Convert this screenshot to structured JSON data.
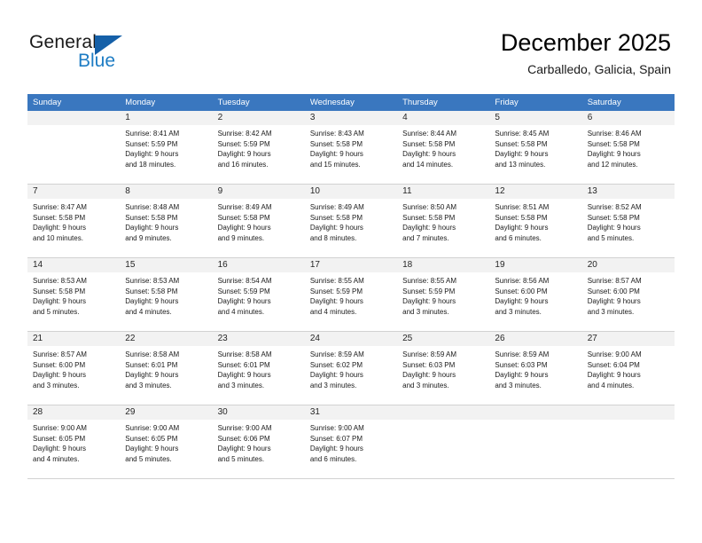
{
  "brand": {
    "name_part1": "General",
    "name_part2": "Blue",
    "triangle_color": "#1560a8",
    "blue_color": "#1d7cc4"
  },
  "header": {
    "title": "December 2025",
    "location": "Carballedo, Galicia, Spain"
  },
  "calendar": {
    "header_bg": "#3a77bf",
    "header_text_color": "#ffffff",
    "weekdays": [
      "Sunday",
      "Monday",
      "Tuesday",
      "Wednesday",
      "Thursday",
      "Friday",
      "Saturday"
    ],
    "weeks": [
      [
        {
          "day": "",
          "sunrise": "",
          "sunset": "",
          "daylight_line1": "",
          "daylight_line2": ""
        },
        {
          "day": "1",
          "sunrise": "Sunrise: 8:41 AM",
          "sunset": "Sunset: 5:59 PM",
          "daylight_line1": "Daylight: 9 hours",
          "daylight_line2": "and 18 minutes."
        },
        {
          "day": "2",
          "sunrise": "Sunrise: 8:42 AM",
          "sunset": "Sunset: 5:59 PM",
          "daylight_line1": "Daylight: 9 hours",
          "daylight_line2": "and 16 minutes."
        },
        {
          "day": "3",
          "sunrise": "Sunrise: 8:43 AM",
          "sunset": "Sunset: 5:58 PM",
          "daylight_line1": "Daylight: 9 hours",
          "daylight_line2": "and 15 minutes."
        },
        {
          "day": "4",
          "sunrise": "Sunrise: 8:44 AM",
          "sunset": "Sunset: 5:58 PM",
          "daylight_line1": "Daylight: 9 hours",
          "daylight_line2": "and 14 minutes."
        },
        {
          "day": "5",
          "sunrise": "Sunrise: 8:45 AM",
          "sunset": "Sunset: 5:58 PM",
          "daylight_line1": "Daylight: 9 hours",
          "daylight_line2": "and 13 minutes."
        },
        {
          "day": "6",
          "sunrise": "Sunrise: 8:46 AM",
          "sunset": "Sunset: 5:58 PM",
          "daylight_line1": "Daylight: 9 hours",
          "daylight_line2": "and 12 minutes."
        }
      ],
      [
        {
          "day": "7",
          "sunrise": "Sunrise: 8:47 AM",
          "sunset": "Sunset: 5:58 PM",
          "daylight_line1": "Daylight: 9 hours",
          "daylight_line2": "and 10 minutes."
        },
        {
          "day": "8",
          "sunrise": "Sunrise: 8:48 AM",
          "sunset": "Sunset: 5:58 PM",
          "daylight_line1": "Daylight: 9 hours",
          "daylight_line2": "and 9 minutes."
        },
        {
          "day": "9",
          "sunrise": "Sunrise: 8:49 AM",
          "sunset": "Sunset: 5:58 PM",
          "daylight_line1": "Daylight: 9 hours",
          "daylight_line2": "and 9 minutes."
        },
        {
          "day": "10",
          "sunrise": "Sunrise: 8:49 AM",
          "sunset": "Sunset: 5:58 PM",
          "daylight_line1": "Daylight: 9 hours",
          "daylight_line2": "and 8 minutes."
        },
        {
          "day": "11",
          "sunrise": "Sunrise: 8:50 AM",
          "sunset": "Sunset: 5:58 PM",
          "daylight_line1": "Daylight: 9 hours",
          "daylight_line2": "and 7 minutes."
        },
        {
          "day": "12",
          "sunrise": "Sunrise: 8:51 AM",
          "sunset": "Sunset: 5:58 PM",
          "daylight_line1": "Daylight: 9 hours",
          "daylight_line2": "and 6 minutes."
        },
        {
          "day": "13",
          "sunrise": "Sunrise: 8:52 AM",
          "sunset": "Sunset: 5:58 PM",
          "daylight_line1": "Daylight: 9 hours",
          "daylight_line2": "and 5 minutes."
        }
      ],
      [
        {
          "day": "14",
          "sunrise": "Sunrise: 8:53 AM",
          "sunset": "Sunset: 5:58 PM",
          "daylight_line1": "Daylight: 9 hours",
          "daylight_line2": "and 5 minutes."
        },
        {
          "day": "15",
          "sunrise": "Sunrise: 8:53 AM",
          "sunset": "Sunset: 5:58 PM",
          "daylight_line1": "Daylight: 9 hours",
          "daylight_line2": "and 4 minutes."
        },
        {
          "day": "16",
          "sunrise": "Sunrise: 8:54 AM",
          "sunset": "Sunset: 5:59 PM",
          "daylight_line1": "Daylight: 9 hours",
          "daylight_line2": "and 4 minutes."
        },
        {
          "day": "17",
          "sunrise": "Sunrise: 8:55 AM",
          "sunset": "Sunset: 5:59 PM",
          "daylight_line1": "Daylight: 9 hours",
          "daylight_line2": "and 4 minutes."
        },
        {
          "day": "18",
          "sunrise": "Sunrise: 8:55 AM",
          "sunset": "Sunset: 5:59 PM",
          "daylight_line1": "Daylight: 9 hours",
          "daylight_line2": "and 3 minutes."
        },
        {
          "day": "19",
          "sunrise": "Sunrise: 8:56 AM",
          "sunset": "Sunset: 6:00 PM",
          "daylight_line1": "Daylight: 9 hours",
          "daylight_line2": "and 3 minutes."
        },
        {
          "day": "20",
          "sunrise": "Sunrise: 8:57 AM",
          "sunset": "Sunset: 6:00 PM",
          "daylight_line1": "Daylight: 9 hours",
          "daylight_line2": "and 3 minutes."
        }
      ],
      [
        {
          "day": "21",
          "sunrise": "Sunrise: 8:57 AM",
          "sunset": "Sunset: 6:00 PM",
          "daylight_line1": "Daylight: 9 hours",
          "daylight_line2": "and 3 minutes."
        },
        {
          "day": "22",
          "sunrise": "Sunrise: 8:58 AM",
          "sunset": "Sunset: 6:01 PM",
          "daylight_line1": "Daylight: 9 hours",
          "daylight_line2": "and 3 minutes."
        },
        {
          "day": "23",
          "sunrise": "Sunrise: 8:58 AM",
          "sunset": "Sunset: 6:01 PM",
          "daylight_line1": "Daylight: 9 hours",
          "daylight_line2": "and 3 minutes."
        },
        {
          "day": "24",
          "sunrise": "Sunrise: 8:59 AM",
          "sunset": "Sunset: 6:02 PM",
          "daylight_line1": "Daylight: 9 hours",
          "daylight_line2": "and 3 minutes."
        },
        {
          "day": "25",
          "sunrise": "Sunrise: 8:59 AM",
          "sunset": "Sunset: 6:03 PM",
          "daylight_line1": "Daylight: 9 hours",
          "daylight_line2": "and 3 minutes."
        },
        {
          "day": "26",
          "sunrise": "Sunrise: 8:59 AM",
          "sunset": "Sunset: 6:03 PM",
          "daylight_line1": "Daylight: 9 hours",
          "daylight_line2": "and 3 minutes."
        },
        {
          "day": "27",
          "sunrise": "Sunrise: 9:00 AM",
          "sunset": "Sunset: 6:04 PM",
          "daylight_line1": "Daylight: 9 hours",
          "daylight_line2": "and 4 minutes."
        }
      ],
      [
        {
          "day": "28",
          "sunrise": "Sunrise: 9:00 AM",
          "sunset": "Sunset: 6:05 PM",
          "daylight_line1": "Daylight: 9 hours",
          "daylight_line2": "and 4 minutes."
        },
        {
          "day": "29",
          "sunrise": "Sunrise: 9:00 AM",
          "sunset": "Sunset: 6:05 PM",
          "daylight_line1": "Daylight: 9 hours",
          "daylight_line2": "and 5 minutes."
        },
        {
          "day": "30",
          "sunrise": "Sunrise: 9:00 AM",
          "sunset": "Sunset: 6:06 PM",
          "daylight_line1": "Daylight: 9 hours",
          "daylight_line2": "and 5 minutes."
        },
        {
          "day": "31",
          "sunrise": "Sunrise: 9:00 AM",
          "sunset": "Sunset: 6:07 PM",
          "daylight_line1": "Daylight: 9 hours",
          "daylight_line2": "and 6 minutes."
        },
        {
          "day": "",
          "sunrise": "",
          "sunset": "",
          "daylight_line1": "",
          "daylight_line2": ""
        },
        {
          "day": "",
          "sunrise": "",
          "sunset": "",
          "daylight_line1": "",
          "daylight_line2": ""
        },
        {
          "day": "",
          "sunrise": "",
          "sunset": "",
          "daylight_line1": "",
          "daylight_line2": ""
        }
      ]
    ]
  }
}
